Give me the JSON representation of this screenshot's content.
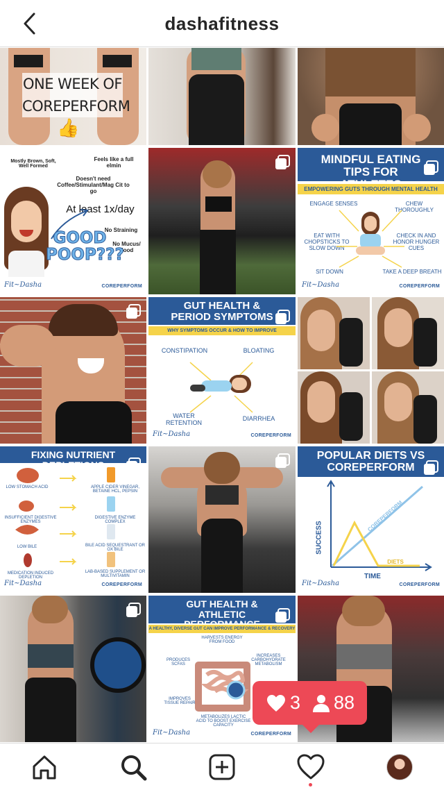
{
  "header": {
    "title": "dashafitness"
  },
  "tiles": {
    "t1": {
      "caption_line1": "ONE WEEK OF",
      "caption_line2": "COREPERFORM"
    },
    "t4": {
      "l1": "Mostly Brown, Soft, Well Formed",
      "l2": "Feels like a full elmin",
      "l3": "Doesn't need Coffee/Stimulant/Mag Cit to go",
      "l4": "At least 1x/day",
      "l5": "No Straining",
      "l6": "No Mucus/ Food",
      "l7": "GOOD POOP???",
      "sig": "Fit~Dasha",
      "brand": "COREPERFORM"
    },
    "t6": {
      "title": "MINDFUL EATING TIPS FOR ATHLETES",
      "sub": "EMPOWERING GUTS THROUGH MENTAL HEALTH",
      "a": "ENGAGE SENSES",
      "b": "CHEW THOROUGHLY",
      "c": "EAT WITH CHOPSTICKS TO SLOW DOWN",
      "d": "CHECK IN AND HONOR HUNGER CUES",
      "e": "SIT DOWN",
      "f": "TAKE A DEEP BREATH",
      "sig": "Fit~Dasha",
      "brand": "COREPERFORM"
    },
    "t8": {
      "title": "GUT HEALTH & PERIOD SYMPTOMS",
      "sub": "WHY SYMPTOMS OCCUR & HOW TO IMPROVE",
      "a": "CONSTIPATION",
      "b": "BLOATING",
      "c": "WATER RETENTION",
      "d": "DIARRHEA",
      "sig": "Fit~Dasha",
      "brand": "COREPERFORM"
    },
    "t10": {
      "title": "FIXING NUTRIENT DEPLETIONS",
      "r1l": "LOW STOMACH ACID",
      "r1r": "APPLE CIDER VINEGAR, BETAINE HCL, PEPSIN",
      "r2l": "INSUFFICIENT DIGESTIVE ENZYMES",
      "r2r": "DIGESTIVE ENZYME COMPLEX",
      "r3l": "LOW BILE",
      "r3r": "BILE ACID SEQUESTRANT OR OX BILE",
      "r4l": "MEDICATION INDUCED DEPLETION",
      "r4r": "LAB-BASED SUPPLEMENT OR MULTIVITAMIN",
      "sig": "Fit~Dasha",
      "brand": "COREPERFORM"
    },
    "t12": {
      "title": "POPULAR DIETS VS COREPERFORM",
      "y": "SUCCESS",
      "x": "TIME",
      "line": "COREPERFORM",
      "diets": "DIETS",
      "sig": "Fit~Dasha",
      "brand": "COREPERFORM"
    },
    "t14": {
      "title": "GUT HEALTH & ATHLETIC PERFORMANCE",
      "sub": "A HEALTHY, DIVERSE GUT CAN IMPROVE PERFORMANCE & RECOVERY",
      "a": "HARVESTS ENERGY FROM FOOD",
      "b": "PRODUCES SCFAs",
      "c": "INCREASES CARBOHYDRATE METABOLISM",
      "d": "IMPROVES TISSUE REPAIR",
      "e": "METABOLIZES LACTIC ACID TO BOOST EXERCISE CAPACITY",
      "sig": "Fit~Dasha",
      "brand": "COREPERFORM"
    }
  },
  "notification": {
    "likes": "3",
    "followers": "88"
  },
  "colors": {
    "accent": "#ed4956",
    "brand_blue": "#2b5a98",
    "brand_yellow": "#f5d34a"
  },
  "icons": [
    "back-chevron-icon",
    "home-icon",
    "search-icon",
    "add-post-icon",
    "heart-icon",
    "avatar",
    "multi-post-icon",
    "person-icon"
  ]
}
